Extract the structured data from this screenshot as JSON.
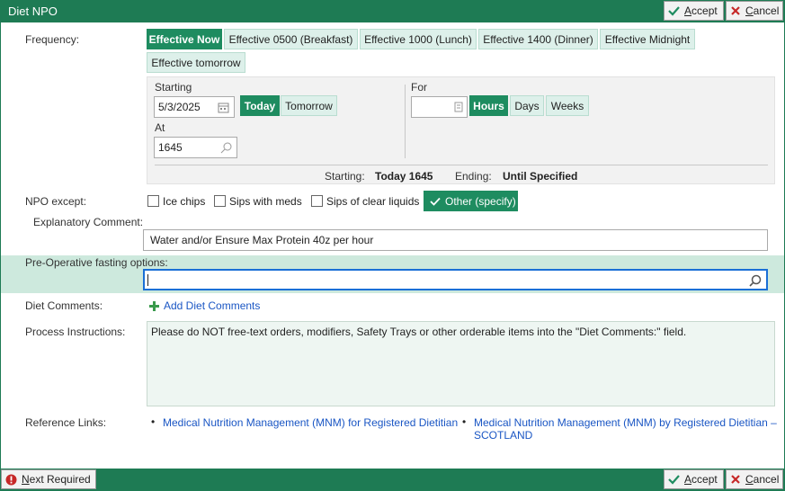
{
  "window": {
    "title": "Diet NPO"
  },
  "top_buttons": {
    "accept": "Accept",
    "cancel": "Cancel"
  },
  "frequency": {
    "label": "Frequency:",
    "options": [
      "Effective Now",
      "Effective 0500 (Breakfast)",
      "Effective 1000 (Lunch)",
      "Effective 1400 (Dinner)",
      "Effective Midnight",
      "Effective tomorrow"
    ],
    "selected": "Effective Now"
  },
  "schedule": {
    "starting_label": "Starting",
    "starting_value": "5/3/2025",
    "today_label": "Today",
    "tomorrow_label": "Tomorrow",
    "at_label": "At",
    "at_value": "1645",
    "for_label": "For",
    "for_value": "",
    "hours_label": "Hours",
    "days_label": "Days",
    "weeks_label": "Weeks",
    "summary_starting_label": "Starting:",
    "summary_starting_value": "Today 1645",
    "summary_ending_label": "Ending:",
    "summary_ending_value": "Until Specified"
  },
  "npo_except": {
    "label": "NPO except:",
    "options": [
      {
        "label": "Ice chips",
        "checked": false
      },
      {
        "label": "Sips with meds",
        "checked": false
      },
      {
        "label": "Sips of clear liquids",
        "checked": false
      },
      {
        "label": "Other (specify)",
        "checked": true
      }
    ]
  },
  "explanatory": {
    "label": "Explanatory Comment:",
    "value": "Water and/or Ensure Max Protein 40z per hour"
  },
  "pre_op": {
    "label": "Pre-Operative fasting options:",
    "value": ""
  },
  "diet_comments": {
    "label": "Diet Comments:",
    "add_label": "Add Diet Comments"
  },
  "process": {
    "label": "Process Instructions:",
    "text": "Please do NOT free-text orders, modifiers, Safety Trays or other orderable items into the \"Diet Comments:\" field."
  },
  "reference": {
    "label": "Reference Links:",
    "links": [
      "Medical Nutrition Management (MNM) for Registered Dietitian",
      "Medical Nutrition Management (MNM) by Registered Dietitian – SCOTLAND"
    ]
  },
  "footer": {
    "next_required": "Next Required",
    "accept": "Accept",
    "cancel": "Cancel"
  },
  "colors": {
    "brand": "#1e7b54",
    "selected": "#1e8c60",
    "chip": "#ddf0ea",
    "link": "#1a56c4"
  }
}
